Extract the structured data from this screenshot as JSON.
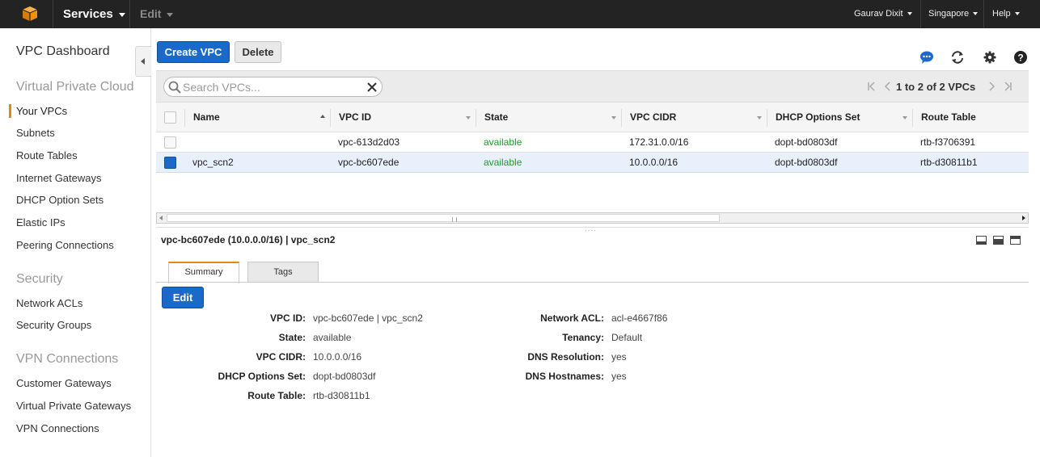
{
  "topnav": {
    "services": "Services",
    "edit": "Edit",
    "user": "Gaurav Dixit",
    "region": "Singapore",
    "help": "Help",
    "logo_color": "#f29111"
  },
  "sidebar": {
    "dashboard": "VPC Dashboard",
    "sections": [
      {
        "title": "Virtual Private Cloud",
        "items": [
          "Your VPCs",
          "Subnets",
          "Route Tables",
          "Internet Gateways",
          "DHCP Option Sets",
          "Elastic IPs",
          "Peering Connections"
        ]
      },
      {
        "title": "Security",
        "items": [
          "Network ACLs",
          "Security Groups"
        ]
      },
      {
        "title": "VPN Connections",
        "items": [
          "Customer Gateways",
          "Virtual Private Gateways",
          "VPN Connections"
        ]
      }
    ],
    "active_item": "Your VPCs"
  },
  "toolbar": {
    "create_label": "Create VPC",
    "delete_label": "Delete",
    "icons": [
      "chat-icon",
      "refresh-icon",
      "gear-icon",
      "help-icon"
    ]
  },
  "search": {
    "placeholder": "Search VPCs..."
  },
  "pager": {
    "text": "1 to 2 of 2 VPCs"
  },
  "table": {
    "columns": [
      "Name",
      "VPC ID",
      "State",
      "VPC CIDR",
      "DHCP Options Set",
      "Route Table"
    ],
    "rows": [
      {
        "name": "",
        "vpc_id": "vpc-613d2d03",
        "state": "available",
        "cidr": "172.31.0.0/16",
        "dhcp": "dopt-bd0803df",
        "route": "rtb-f3706391",
        "selected": false
      },
      {
        "name": "vpc_scn2",
        "vpc_id": "vpc-bc607ede",
        "state": "available",
        "cidr": "10.0.0.0/16",
        "dhcp": "dopt-bd0803df",
        "route": "rtb-d30811b1",
        "selected": true
      }
    ]
  },
  "detail": {
    "title": "vpc-bc607ede (10.0.0.0/16) | vpc_scn2",
    "tabs": [
      "Summary",
      "Tags"
    ],
    "edit_label": "Edit",
    "left": [
      {
        "label": "VPC ID:",
        "value": "vpc-bc607ede | vpc_scn2"
      },
      {
        "label": "State:",
        "value": "available"
      },
      {
        "label": "VPC CIDR:",
        "value": "10.0.0.0/16"
      },
      {
        "label": "DHCP Options Set:",
        "value": "dopt-bd0803df"
      },
      {
        "label": "Route Table:",
        "value": "rtb-d30811b1"
      }
    ],
    "right": [
      {
        "label": "Network ACL:",
        "value": "acl-e4667f86"
      },
      {
        "label": "Tenancy:",
        "value": "Default"
      },
      {
        "label": "DNS Resolution:",
        "value": "yes"
      },
      {
        "label": "DNS Hostnames:",
        "value": "yes"
      }
    ]
  },
  "colors": {
    "primary": "#1b6ac9",
    "accent": "#e8850c",
    "available": "#1e9a2b"
  }
}
